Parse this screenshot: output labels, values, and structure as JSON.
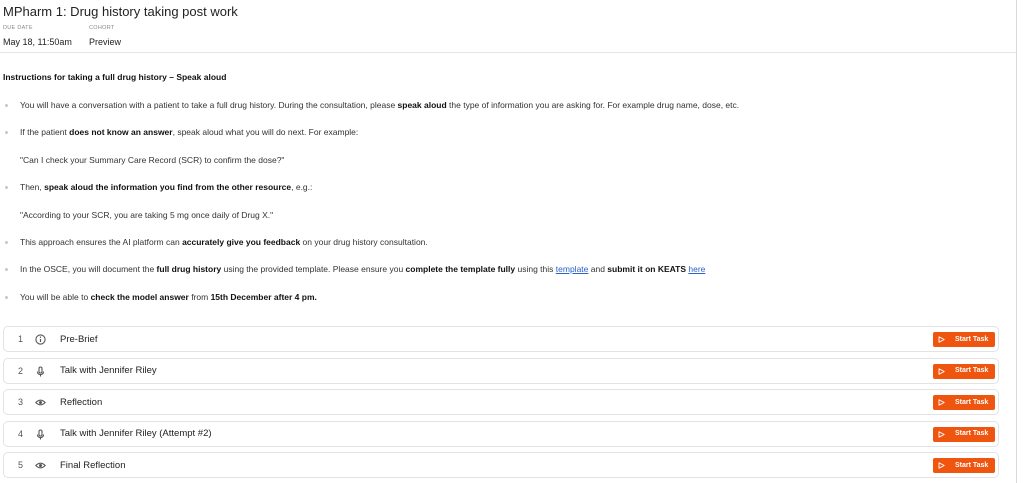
{
  "header": {
    "title": "MPharm 1: Drug history taking post work",
    "due_date_label": "DUE DATE",
    "due_date_value": "May 18, 11:50am",
    "cohort_label": "COHORT",
    "cohort_value": "Preview"
  },
  "instructions": {
    "heading": "Instructions for taking a full drug history – Speak aloud",
    "items": [
      {
        "parts": [
          {
            "text": "You will have a conversation with a patient to take a full drug history. During the consultation, please "
          },
          {
            "text": "speak aloud",
            "bold": true
          },
          {
            "text": " the type of information you are asking for. For example drug name, dose, etc."
          }
        ]
      },
      {
        "parts": [
          {
            "text": "If the patient "
          },
          {
            "text": "does not know an answer",
            "bold": true
          },
          {
            "text": ", speak aloud what you will do next. For example:"
          }
        ]
      },
      {
        "quote": true,
        "parts": [
          {
            "text": "\"Can I check your Summary Care Record (SCR) to confirm the dose?\""
          }
        ]
      },
      {
        "parts": [
          {
            "text": "Then, "
          },
          {
            "text": "speak aloud the information you find from the other resource",
            "bold": true
          },
          {
            "text": ", e.g.:"
          }
        ]
      },
      {
        "quote": true,
        "parts": [
          {
            "text": "\"According to your SCR, you are taking 5 mg once daily of Drug X.\""
          }
        ]
      },
      {
        "parts": [
          {
            "text": "This approach ensures the AI platform can "
          },
          {
            "text": "accurately give you feedback",
            "bold": true
          },
          {
            "text": " on your drug history consultation."
          }
        ]
      },
      {
        "parts": [
          {
            "text": "In the OSCE, you will document the "
          },
          {
            "text": "full drug history",
            "bold": true
          },
          {
            "text": " using the provided template. Please ensure you "
          },
          {
            "text": "complete the template fully",
            "bold": true
          },
          {
            "text": " using this "
          },
          {
            "text": "template",
            "link": true
          },
          {
            "text": " and "
          },
          {
            "text": "submit it on KEATS",
            "bold": true
          },
          {
            "text": " "
          },
          {
            "text": "here",
            "link": true
          }
        ]
      },
      {
        "parts": [
          {
            "text": "You will be able to "
          },
          {
            "text": "check the model answer",
            "bold": true
          },
          {
            "text": " from "
          },
          {
            "text": "15th December after 4 pm.",
            "bold": true
          }
        ]
      }
    ]
  },
  "tasks": [
    {
      "number": "1",
      "icon": "info-icon",
      "label": "Pre-Brief",
      "button": "Start Task"
    },
    {
      "number": "2",
      "icon": "microphone-icon",
      "label": "Talk with Jennifer Riley",
      "button": "Start Task"
    },
    {
      "number": "3",
      "icon": "eye-icon",
      "label": "Reflection",
      "button": "Start Task"
    },
    {
      "number": "4",
      "icon": "microphone-icon",
      "label": "Talk with Jennifer Riley (Attempt #2)",
      "button": "Start Task"
    },
    {
      "number": "5",
      "icon": "eye-icon",
      "label": "Final Reflection",
      "button": "Start Task"
    }
  ],
  "colors": {
    "accent": "#f0550f",
    "link": "#2b61c8"
  }
}
